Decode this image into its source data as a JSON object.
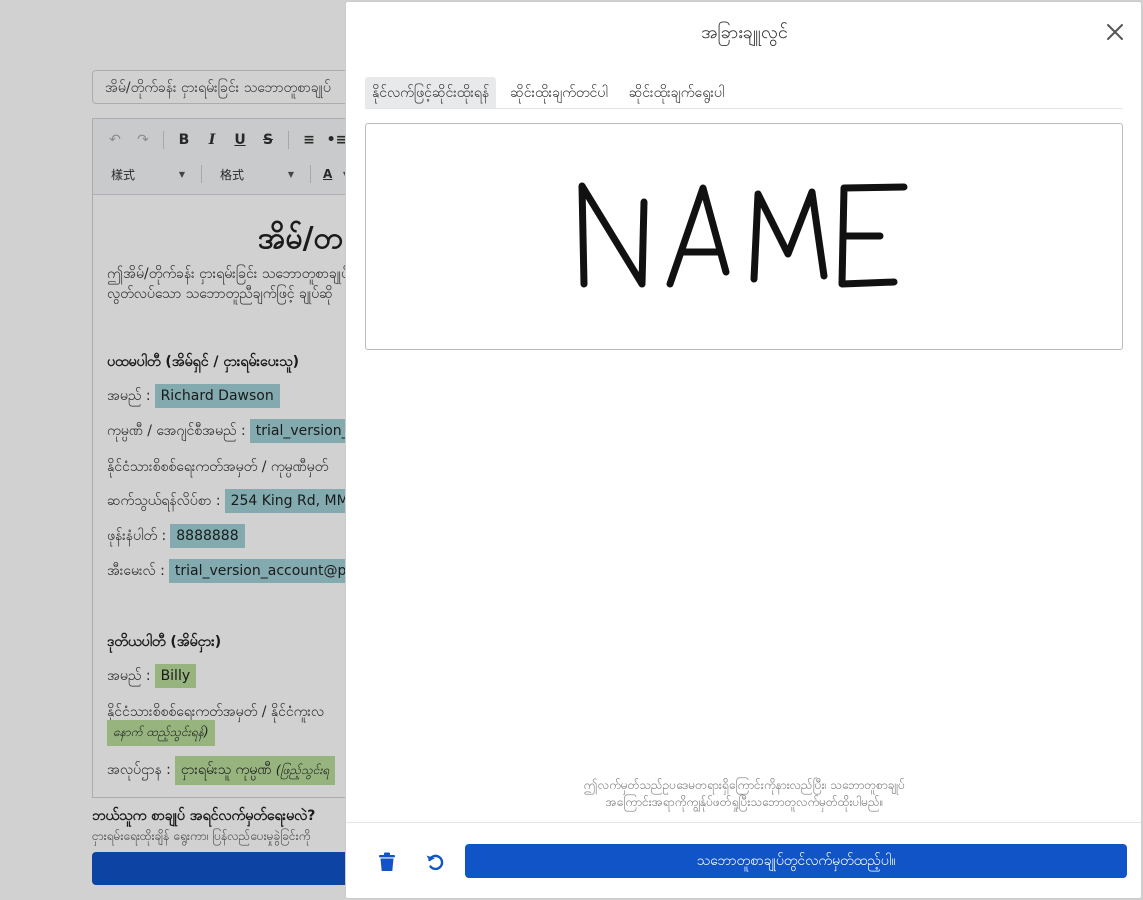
{
  "background": {
    "doc_title_value": "အိမ်/တိုက်ခန်း ငှားရမ်းခြင်း သဘောတူစာချုပ်",
    "toolbar": {
      "style_label": "樣式",
      "format_label": "格式",
      "font_color_label": "A"
    },
    "document": {
      "heading": "အိမ်/တ",
      "intro_line1": "ဤအိမ်/တိုက်ခန်း ငှားရမ်းခြင်း သဘောတူစာချုပ်",
      "intro_line2": "လွတ်လပ်သော သဘောတူညီချက်ဖြင့် ချုပ်ဆို",
      "party1_heading": "ပထမပါတီ (အိမ်ရှင် / ငှားရမ်းပေးသူ)",
      "party1_name_label": "အမည် :",
      "party1_name_value": "Richard Dawson",
      "party1_company_label": "ကုမ္ပဏီ / အေဂျင်စီအမည် :",
      "party1_company_value": "trial_version_",
      "party1_id_label": "နိုင်ငံသားစိစစ်ရေးကတ်အမှတ် / ကုမ္ပဏီမှတ်",
      "party1_address_label": "ဆက်သွယ်ရန်လိပ်စာ :",
      "party1_address_value": "254 King Rd, MM",
      "party1_phone_label": "ဖုန်းနံပါတ် :",
      "party1_phone_value": "8888888",
      "party1_email_label": "အီးမေးလ် :",
      "party1_email_value": "trial_version_account@pack",
      "party2_heading": "ဒုတိယပါတီ (အိမ်ငှား)",
      "party2_name_label": "အမည် :",
      "party2_name_value": "Billy",
      "party2_id_label": "နိုင်ငံသားစိစစ်ရေးကတ်အမှတ် / နိုင်ငံကူးလ",
      "party2_id_note": "နောက် ထည့်သွင်းရန်)",
      "party2_job_label": "အလုပ်ဌာန :",
      "party2_job_value": "ငှားရမ်းသူ ကုမ္ပဏီ",
      "party2_job_note": "(ဖြည့်သွင်းရ"
    },
    "who_sign": "ဘယ်သူက စာချုပ် အရင်လက်မှတ်ရေးမလဲ?",
    "who_sign_sub": "ငှားရမ်းရေးထိုးချိန် ရွေးကာ၊ ပြန်လည်ပေးမှုခွဲခြင်းကို"
  },
  "modal": {
    "title": "အခြားချူလွင်",
    "tabs": [
      {
        "label": "နိုင်လက်ဖြင့်ဆိုင်းထိုးရန်",
        "active": true
      },
      {
        "label": "ဆိုင်းထိုးချက်တင်ပါ",
        "active": false
      },
      {
        "label": "ဆိုင်းထိုးချက်ရွေးပါ",
        "active": false
      }
    ],
    "disclaimer_line1": "ဤလက်မှတ်သည်ဥပဒေမတရားရှိကြောင်းကိုနားလည်ပြီး၊ သဘောတူစာချုပ်",
    "disclaimer_line2": "အကြောင်းအရာကိုကျွန်ုပ်ဖတ်ရှုပြီးသဘောတူလက်မှတ်ထိုးပါမည်။",
    "sign_button": "သဘောတူစာချုပ်တွင်လက်မှတ်ထည့်ပါ။",
    "colors": {
      "primary": "#1054c8",
      "icon_blue": "#1054c8",
      "stroke": "#111111"
    }
  }
}
